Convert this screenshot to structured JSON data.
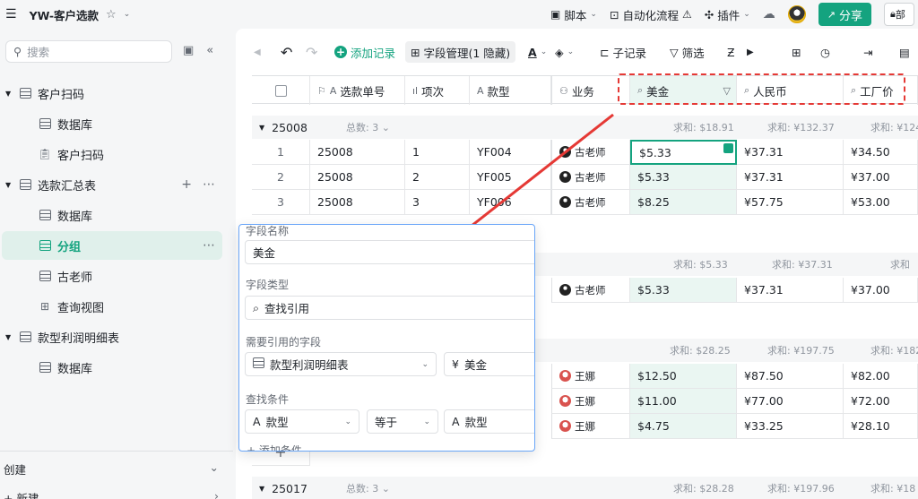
{
  "app": {
    "doc_title": "YW-客户选款",
    "menu_icon": "hamburger-icon",
    "star_icon": "star-icon"
  },
  "topbar": {
    "script_label": "脚本",
    "automation_label": "自动化流程",
    "plugin_label": "插件",
    "share_label": "分享",
    "more_label": "部"
  },
  "sidebar": {
    "search_placeholder": "搜索",
    "tree": [
      {
        "label": "客户扫码",
        "type": "folder"
      },
      {
        "label": "数据库",
        "type": "table"
      },
      {
        "label": "客户扫码",
        "type": "form"
      },
      {
        "label": "选款汇总表",
        "type": "folder"
      },
      {
        "label": "数据库",
        "type": "table"
      },
      {
        "label": "分组",
        "type": "table",
        "active": true
      },
      {
        "label": "古老师",
        "type": "table"
      },
      {
        "label": "查询视图",
        "type": "query"
      },
      {
        "label": "款型利润明细表",
        "type": "folder"
      },
      {
        "label": "数据库",
        "type": "table"
      }
    ],
    "create_label": "创建",
    "new_label": "新建"
  },
  "toolbar": {
    "add_record": "添加记录",
    "field_manage": "字段管理(1 隐藏)",
    "sub_record": "子记录",
    "filter": "筛选"
  },
  "columns": [
    "选款单号",
    "项次",
    "款型",
    "业务",
    "美金",
    "人民币",
    "工厂价"
  ],
  "groups": [
    {
      "name": "25008",
      "total": "总数: 3",
      "sums": {
        "usd": "求和: $18.91",
        "rmb": "求和: ¥132.37",
        "factory": "求和: ¥124"
      },
      "rows": [
        {
          "idx": "1",
          "order": "25008",
          "item": "1",
          "style": "YF004",
          "owner": "古老师",
          "usd": "$5.33",
          "rmb": "¥37.31",
          "factory": "¥34.50"
        },
        {
          "idx": "2",
          "order": "25008",
          "item": "2",
          "style": "YF005",
          "owner": "古老师",
          "usd": "$5.33",
          "rmb": "¥37.31",
          "factory": "¥37.00"
        },
        {
          "idx": "3",
          "order": "25008",
          "item": "3",
          "style": "YF006",
          "owner": "古老师",
          "usd": "$8.25",
          "rmb": "¥57.75",
          "factory": "¥53.00"
        }
      ]
    },
    {
      "name": "",
      "total": "",
      "sums": {
        "usd": "求和: $5.33",
        "rmb": "求和: ¥37.31",
        "factory": "求和"
      },
      "rows": [
        {
          "idx": "",
          "order": "",
          "item": "",
          "style": "",
          "owner": "古老师",
          "usd": "$5.33",
          "rmb": "¥37.31",
          "factory": "¥37.00"
        }
      ]
    },
    {
      "name": "",
      "total": "",
      "sums": {
        "usd": "求和: $28.25",
        "rmb": "求和: ¥197.75",
        "factory": "求和: ¥182"
      },
      "rows": [
        {
          "idx": "",
          "order": "",
          "item": "",
          "style": "",
          "owner": "王娜",
          "usd": "$12.50",
          "rmb": "¥87.50",
          "factory": "¥82.00"
        },
        {
          "idx": "",
          "order": "",
          "item": "",
          "style": "",
          "owner": "王娜",
          "usd": "$11.00",
          "rmb": "¥77.00",
          "factory": "¥72.00"
        },
        {
          "idx": "",
          "order": "",
          "item": "",
          "style": "",
          "owner": "王娜",
          "usd": "$4.75",
          "rmb": "¥33.25",
          "factory": "¥28.10"
        }
      ]
    },
    {
      "name": "25017",
      "total": "总数: 3",
      "sums": {
        "usd": "求和: $28.28",
        "rmb": "求和: ¥197.96",
        "factory": "求和: ¥18"
      },
      "rows": []
    }
  ],
  "popup": {
    "field_name_label": "字段名称",
    "field_name_value": "美金",
    "field_type_label": "字段类型",
    "field_type_value": "查找引用",
    "ref_field_label": "需要引用的字段",
    "ref_table": "款型利润明细表",
    "ref_field": "美金",
    "condition_label": "查找条件",
    "cond_left": "款型",
    "cond_op": "等于",
    "cond_right": "款型",
    "add_condition": "添加条件"
  }
}
